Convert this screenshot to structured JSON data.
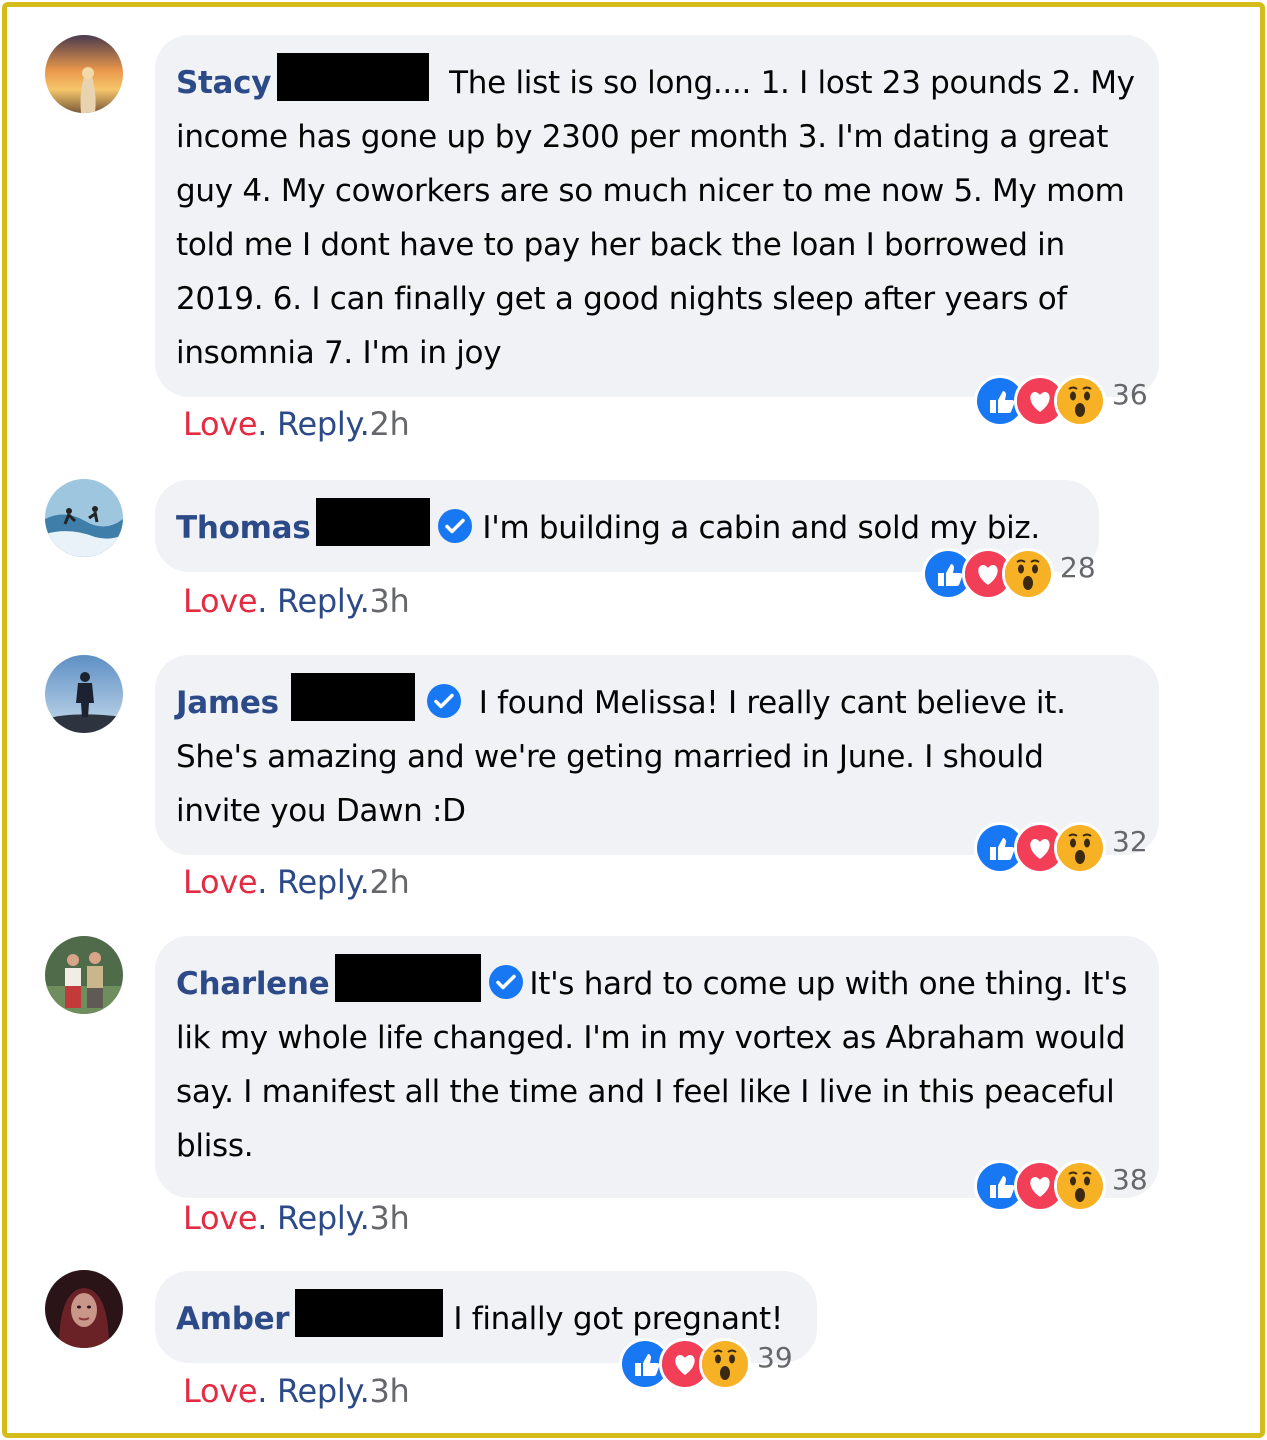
{
  "comments": [
    {
      "author": "Stacy",
      "text": "The list is so long.... 1. I lost 23 pounds 2. My income has gone up by 2300 per month 3. I'm dating a great guy 4. My coworkers are so much nicer to me now 5. My mom told me I dont have to pay her back the loan I borrowed in 2019. 6. I can finally get a good nights sleep after years of insomnia 7. I'm in joy",
      "verified": false,
      "reaction_count": "36",
      "love_label": "Love",
      "reply_label": "Reply",
      "time": "2h"
    },
    {
      "author": "Thomas",
      "text": "I'm building a cabin and sold my biz.",
      "verified": true,
      "reaction_count": "28",
      "love_label": "Love",
      "reply_label": "Reply",
      "time": "3h"
    },
    {
      "author": "James",
      "text": "I found Melissa! I really cant believe it. She's amazing and we're geting married in June. I should invite you Dawn :D",
      "verified": true,
      "reaction_count": "32",
      "love_label": "Love",
      "reply_label": "Reply",
      "time": "2h"
    },
    {
      "author": "Charlene",
      "text": "It's hard to come up with one thing. It's lik my whole life changed. I'm in my vortex as Abraham would say. I manifest all the time and I feel like I live in this peaceful bliss.",
      "verified": true,
      "reaction_count": "38",
      "love_label": "Love",
      "reply_label": "Reply",
      "time": "3h"
    },
    {
      "author": "Amber",
      "text": "I finally got pregnant!",
      "verified": false,
      "reaction_count": "39",
      "love_label": "Love",
      "reply_label": "Reply",
      "time": "3h"
    }
  ],
  "separator": ".",
  "reaction_icons": [
    "like-icon",
    "love-icon",
    "wow-icon"
  ],
  "colors": {
    "frame": "#d4bd1a",
    "author": "#2c4a87",
    "love": "#e42b42",
    "bubble": "#f0f2f5",
    "like": "#1877f2",
    "heart": "#f33e58",
    "wow": "#f7b125"
  }
}
